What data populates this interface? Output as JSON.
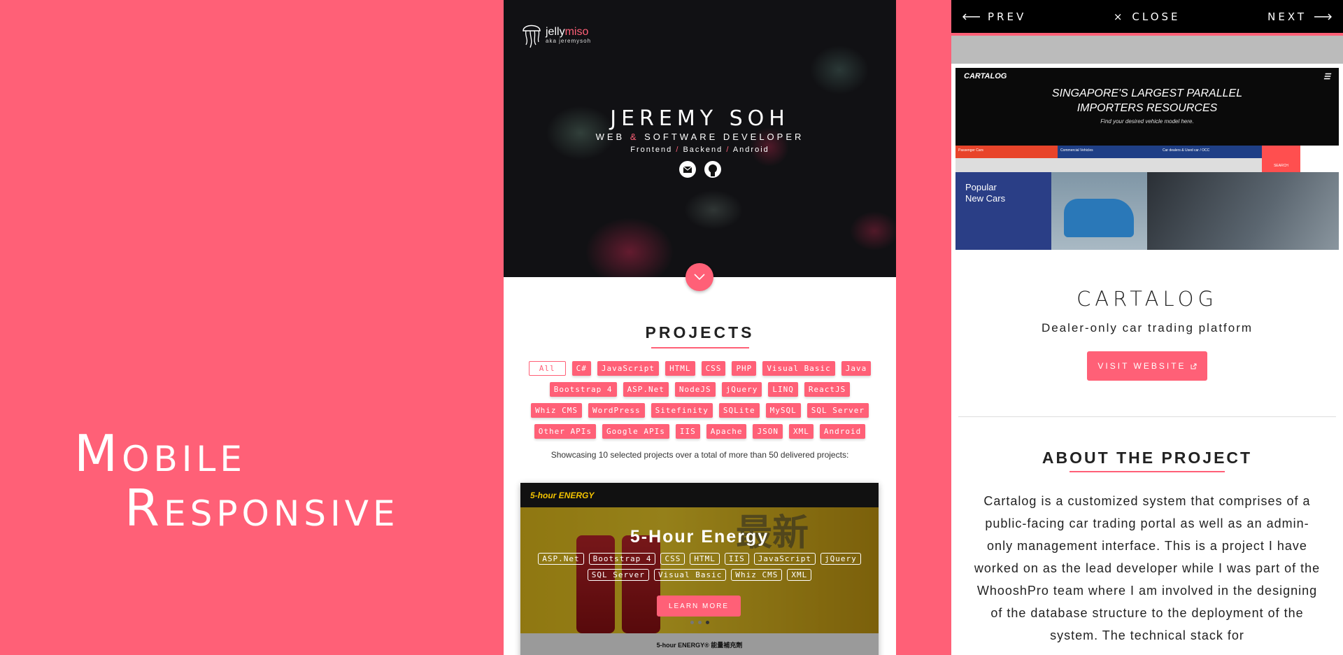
{
  "banner": {
    "line1_cap": "M",
    "line1_rest": "obile",
    "line2_cap": "R",
    "line2_rest": "esponsive"
  },
  "phone1": {
    "logo": {
      "name_a": "jelly",
      "name_b": "miso",
      "aka": "aka jeremysoh"
    },
    "hero": {
      "name": "JEREMY SOH",
      "role_a": "WEB",
      "role_amp": "&",
      "role_b": "SOFTWARE DEVELOPER",
      "skill_a": "Frontend",
      "skill_b": "Backend",
      "skill_c": "Android",
      "sep": "/"
    },
    "projects_heading": "PROJECTS",
    "filters": [
      "All",
      "C#",
      "JavaScript",
      "HTML",
      "CSS",
      "PHP",
      "Visual Basic",
      "Java",
      "Bootstrap 4",
      "ASP.Net",
      "NodeJS",
      "jQuery",
      "LINQ",
      "ReactJS",
      "Whiz CMS",
      "WordPress",
      "Sitefinity",
      "SQLite",
      "MySQL",
      "SQL Server",
      "Other APIs",
      "Google APIs",
      "IIS",
      "Apache",
      "JSON",
      "XML",
      "Android"
    ],
    "showcase_text": "Showcasing 10 selected projects over a total of more than 50 delivered projects:",
    "card": {
      "brand": "5-hour ENERGY",
      "title": "5-Hour Energy",
      "tags": [
        "ASP.Net",
        "Bootstrap 4",
        "CSS",
        "HTML",
        "IIS",
        "JavaScript",
        "jQuery",
        "SQL Server",
        "Visual Basic",
        "Whiz CMS",
        "XML"
      ],
      "learn_more": "LEARN MORE",
      "caption": "5-hour ENERGY® 能量補充劑",
      "cjk": "最新"
    }
  },
  "phone2": {
    "nav": {
      "prev": "PREV",
      "close": "CLOSE",
      "next": "NEXT"
    },
    "screenshot": {
      "logo": "CARTALOG",
      "headline_1": "SINGAPORE'S LARGEST PARALLEL",
      "headline_2": "IMPORTERS RESOURCES",
      "subline": "Find your desired vehicle model here.",
      "col1": "Passenger Cars",
      "col2": "Commercial Vehicles",
      "col3": "Car dealers & Used car / OCC",
      "search": "SEARCH",
      "popular_1": "Popular",
      "popular_2": "New Cars"
    },
    "title": "CARTALOG",
    "subtitle": "Dealer-only car trading platform",
    "visit_label": "VISIT WEBSITE",
    "about_heading": "ABOUT THE PROJECT",
    "about_text": "Cartalog is a customized system that comprises of a public-facing car trading portal as well as an admin-only management interface. This is a project I have worked on as the lead developer while I was part of the WhooshPro team where I am involved in the designing of the database structure to the deployment of the system. The technical stack for"
  },
  "colors": {
    "accent": "#ff6077",
    "dark": "#111114"
  }
}
